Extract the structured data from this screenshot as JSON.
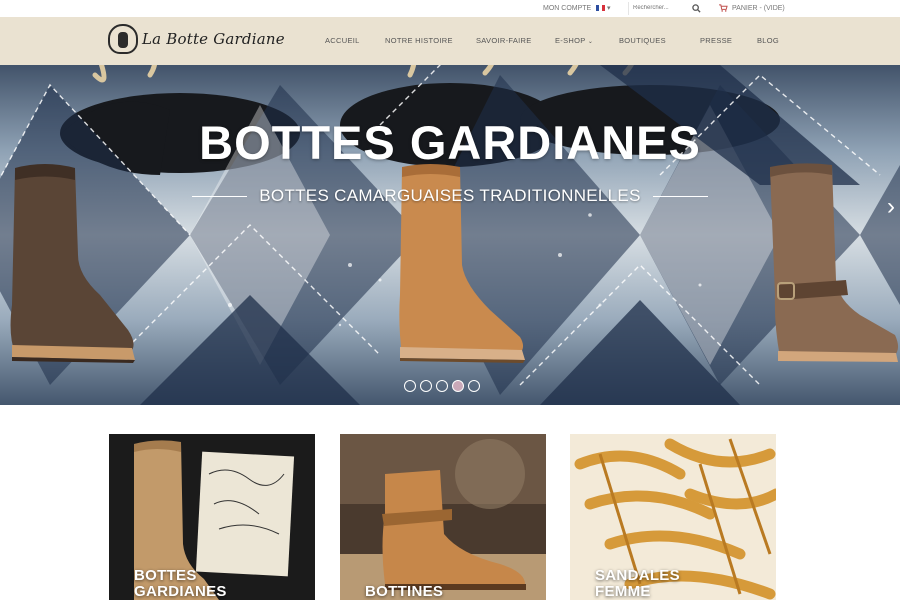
{
  "topbar": {
    "account_label": "MON COMPTE",
    "language_caret": "▾",
    "search_placeholder": "Rechercher...",
    "cart_label": "PANIER - (VIDE)"
  },
  "brand": {
    "name": "La Botte Gardiane"
  },
  "nav": {
    "items": [
      {
        "label": "ACCUEIL"
      },
      {
        "label": "NOTRE HISTOIRE"
      },
      {
        "label": "SAVOIR-FAIRE"
      },
      {
        "label": "E-SHOP"
      },
      {
        "label": "BOUTIQUES"
      },
      {
        "label": "PRESSE"
      },
      {
        "label": "BLOG"
      }
    ],
    "dropdown_caret": "⌄"
  },
  "hero": {
    "title": "BOTTES GARDIANES",
    "subtitle": "BOTTES CAMARGUAISES TRADITIONNELLES",
    "slide_count": 5,
    "active_slide": 4,
    "next_glyph": "›"
  },
  "categories": [
    {
      "title_line1": "BOTTES",
      "title_line2": "GARDIANES"
    },
    {
      "title_line1": "BOTTINES",
      "title_line2": ""
    },
    {
      "title_line1": "SANDALES",
      "title_line2": "FEMME"
    }
  ],
  "colors": {
    "header_bg": "#e8e0ce",
    "boot_brown": "#5a4536",
    "boot_tan": "#c98a4e",
    "boot_suede": "#8a6a52",
    "diamond_navy": "#1f2f4a",
    "sandal_gold": "#d69a3a"
  }
}
